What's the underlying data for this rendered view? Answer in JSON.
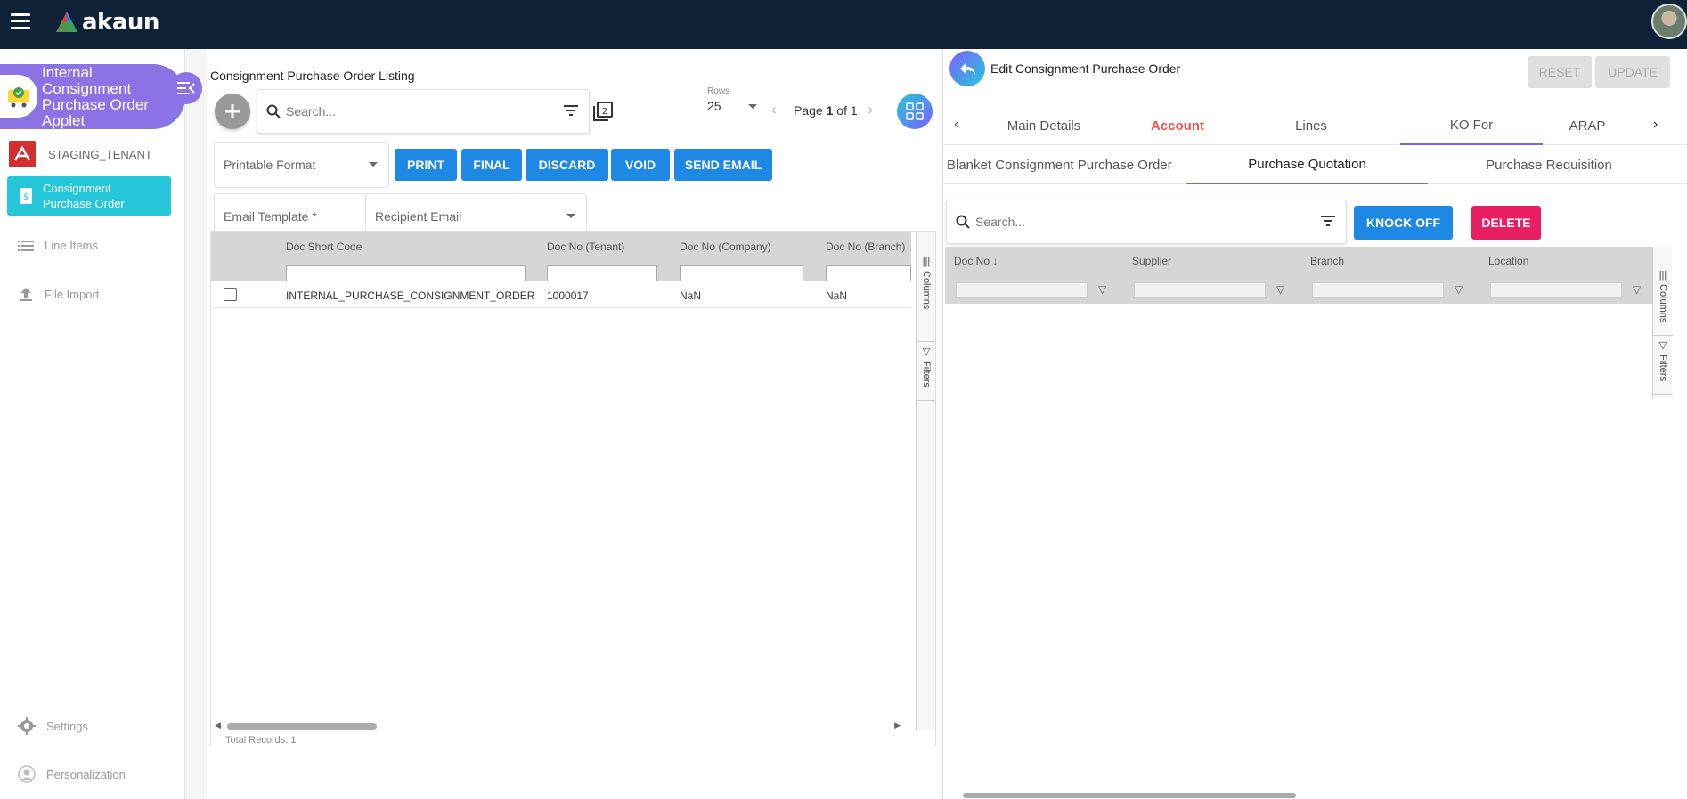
{
  "app": {
    "brand": "akaun"
  },
  "sidebar": {
    "applet_title": "Internal Consignment Purchase Order Applet",
    "tenant": "STAGING_TENANT",
    "active_item": "Consignment Purchase Order",
    "items": [
      {
        "label": "Line Items",
        "icon": "list-icon"
      },
      {
        "label": "File Import",
        "icon": "upload-icon"
      }
    ],
    "footer": [
      {
        "label": "Settings",
        "icon": "gear-icon"
      },
      {
        "label": "Personalization",
        "icon": "person-icon"
      }
    ]
  },
  "listing": {
    "title": "Consignment Purchase Order Listing",
    "search_placeholder": "Search...",
    "rows_label": "Rows",
    "rows_value": "25",
    "page_prefix": "Page ",
    "page_current": "1",
    "page_suffix": " of 1",
    "printable_format": "Printable Format",
    "actions": [
      "PRINT",
      "FINAL",
      "DISCARD",
      "VOID",
      "SEND EMAIL"
    ],
    "email_template": "Email Template *",
    "recipient_email": "Recipient Email",
    "columns": [
      "Doc Short Code",
      "Doc No (Tenant)",
      "Doc No (Company)",
      "Doc No (Branch)"
    ],
    "rows": [
      [
        "INTERNAL_PURCHASE_CONSIGNMENT_ORDER",
        "1000017",
        "NaN",
        "NaN"
      ]
    ],
    "side_tools": [
      "Columns",
      "Filters"
    ],
    "total_records": "Total Records: 1"
  },
  "editor": {
    "title": "Edit Consignment Purchase Order",
    "reset_label": "RESET",
    "update_label": "UPDATE",
    "tabs": [
      "Main Details",
      "Account",
      "Lines",
      "KO For",
      "ARAP"
    ],
    "active_tab": "Account",
    "subtabs": [
      "Blanket Consignment Purchase Order",
      "Purchase Quotation",
      "Purchase Requisition"
    ],
    "active_subtab": "Purchase Quotation",
    "search_placeholder": "Search...",
    "knock_off_label": "KNOCK OFF",
    "delete_label": "DELETE",
    "columns": [
      "Doc No",
      "Supplier",
      "Branch",
      "Location"
    ],
    "sort_indicator": "↓",
    "side_tools": [
      "Columns",
      "Filters"
    ]
  },
  "colors": {
    "topbar": "#0f2136",
    "applet_header": "#8b73e6",
    "active_nav": "#26c6da",
    "primary_button": "#1e88e5",
    "delete_button": "#e91e63",
    "active_tab_text": "#ef5350",
    "tab_ink": "#7b61ff"
  }
}
